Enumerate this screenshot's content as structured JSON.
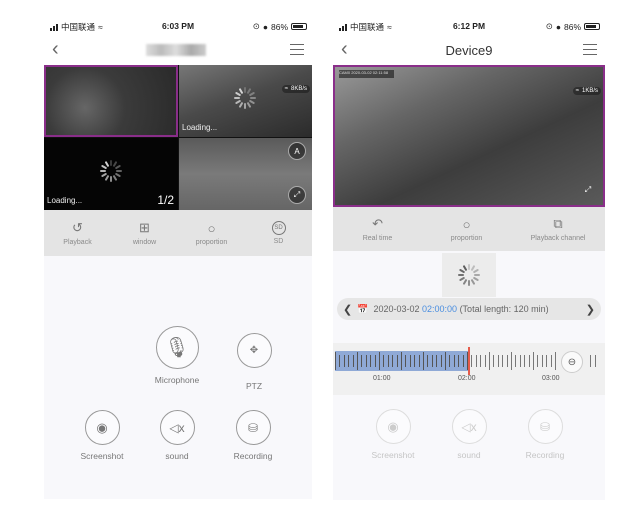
{
  "left_screen": {
    "status": {
      "carrier": "中国联通",
      "time": "6:03 PM",
      "battery": "86%"
    },
    "nav": {
      "title": ""
    },
    "grid": {
      "cells": [
        {
          "name": "camera-1",
          "loading": false,
          "selected": true
        },
        {
          "name": "camera-2",
          "loading": true,
          "loading_text": "Loading...",
          "speed": "8KB/s"
        },
        {
          "name": "camera-3",
          "loading": true,
          "loading_text": "Loading..."
        },
        {
          "name": "camera-4",
          "loading": false
        }
      ],
      "page_indicator": "1/2",
      "auto_label": "A"
    },
    "toolbar": [
      {
        "label": "Playback",
        "icon": "playback-icon"
      },
      {
        "label": "window",
        "icon": "window-grid-icon"
      },
      {
        "label": "proportion",
        "icon": "proportion-icon"
      },
      {
        "label": "SD",
        "icon": "sd-icon"
      }
    ],
    "controls": {
      "microphone": "Microphone",
      "ptz": "PTZ",
      "screenshot": "Screenshot",
      "sound": "sound",
      "recording": "Recording"
    }
  },
  "right_screen": {
    "status": {
      "carrier": "中国联通",
      "time": "6:12 PM",
      "battery": "86%"
    },
    "nav": {
      "title": "Device9"
    },
    "video": {
      "speed": "1KB/s",
      "osd": "CAM0 2020-03-02 02:11:58"
    },
    "toolbar": [
      {
        "label": "Real time",
        "icon": "real-time-icon"
      },
      {
        "label": "proportion",
        "icon": "proportion-icon"
      },
      {
        "label": "Playback channel",
        "icon": "playback-channel-icon"
      }
    ],
    "datebar": {
      "date": "2020-03-02",
      "time": "02:00:00",
      "total": "(Total length: 120 min)"
    },
    "timeline": {
      "labels": [
        "01:00",
        "02:00",
        "03:00"
      ],
      "recorded_until": "02:00"
    },
    "controls": {
      "screenshot": "Screenshot",
      "sound": "sound",
      "recording": "Recording"
    }
  }
}
